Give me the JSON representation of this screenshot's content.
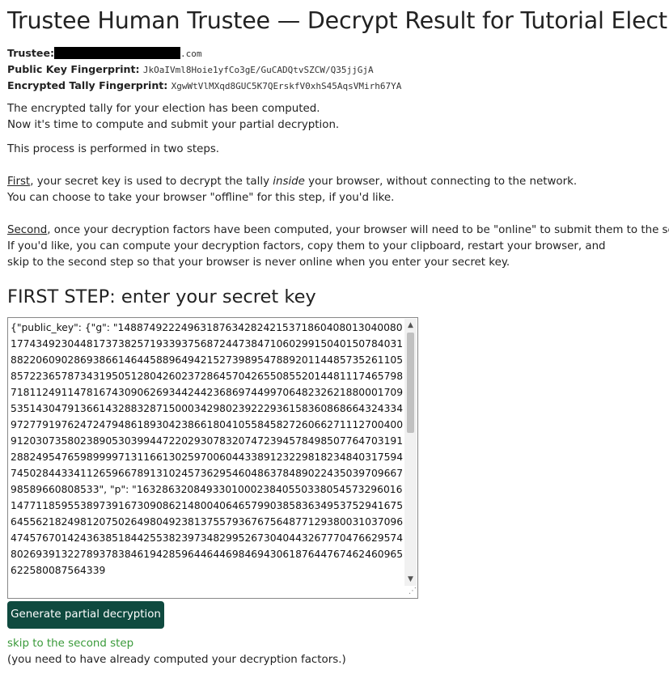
{
  "title": "Trustee Human Trustee — Decrypt Result for Tutorial Election",
  "trustee": {
    "label": "Trustee:",
    "email_suffix": ".com",
    "public_key_label": "Public Key Fingerprint:",
    "public_key_value": "JkOaIVml8Hoie1yfCo3gE/GuCADQtvSZCW/Q35jjGjA",
    "tally_label": "Encrypted Tally Fingerprint:",
    "tally_value": "XgwWtVlMXqd8GUC5K7QErskfV0xhS45AqsVMirh67YA"
  },
  "intro": {
    "line1": "The encrypted tally for your election has been computed.",
    "line2": "Now it's time to compute and submit your partial decryption.",
    "line3": "This process is performed in two steps."
  },
  "first_para": {
    "first_word": "First",
    "part1": ", your secret key is used to decrypt the tally ",
    "inside": "inside",
    "part2": " your browser, without connecting to the network.",
    "line2": "You can choose to take your browser \"offline\" for this step, if you'd like."
  },
  "second_para": {
    "second_word": "Second",
    "part1": ", once your decryption factors have been computed, your browser will need to be \"online\" to submit them to the server.",
    "line2": "If you'd like, you can compute your decryption factors, copy them to your clipboard, restart your browser, and",
    "line3": "skip to the second step so that your browser is never online when you enter your secret key."
  },
  "step1_heading": "FIRST STEP: enter your secret key",
  "secret_key_text": "{\"public_key\": {\"g\": \"14887492224963187634282421537186040801304008017743492304481737382571933937568724473847106029915040150784031882206090286938661464458896494215273989547889201144857352611058572236578734319505128042602372864570426550855201448111746579871811249114781674309062693442442368697449970648232621880001709535143047913661432883287150003429802392229361583608686643243349727791976247247948618930423866180410558458272606627111270040091203073580238905303994472202930783207472394578498507764703191288249547659899997131166130259700604433891232298182348403175947450284433411265966789131024573629546048637848902243503970966798589660808533\", \"p\": \"16328632084933010002384055033805457329601614771185955389739167309086214800406465799038583634953752941675645562182498120750264980492381375579367675648771293800310370964745767014243638518442553823973482995267304044326777047662957480269391322789378384619428596446446984694306187644767462460965622580087564339",
  "generate_button": "Generate partial decryption",
  "skip_link": "skip to the second step",
  "skip_note": "(you need to have already computed your decryption factors.)"
}
